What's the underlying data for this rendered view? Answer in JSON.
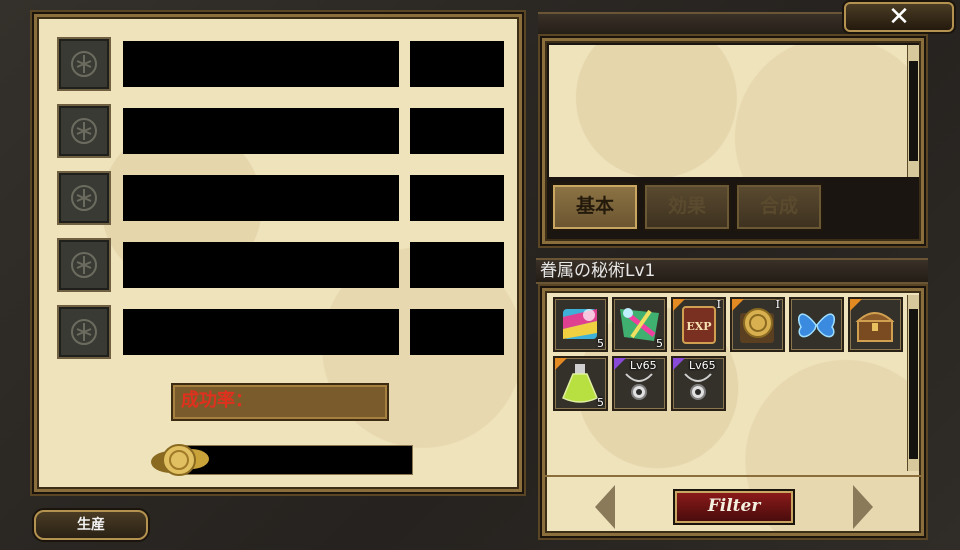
{
  "craft": {
    "rows": [
      {
        "slot_icon": "empty-slot-icon"
      },
      {
        "slot_icon": "empty-slot-icon"
      },
      {
        "slot_icon": "empty-slot-icon"
      },
      {
        "slot_icon": "empty-slot-icon"
      },
      {
        "slot_icon": "empty-slot-icon"
      }
    ],
    "success_label": "成功率：",
    "produce_label": "生産"
  },
  "detail": {
    "close_label": "✕",
    "tabs": [
      {
        "label": "基本",
        "active": true
      },
      {
        "label": "効果",
        "active": false
      },
      {
        "label": "合成",
        "active": false
      }
    ]
  },
  "inventory": {
    "title": "眷属の秘術Lv1",
    "filter_label": "Filter",
    "items": [
      {
        "icon": "rainbow-scroll-icon",
        "qty": "5",
        "tag": "",
        "roman": "",
        "lv": ""
      },
      {
        "icon": "rainbow-scroll-icon",
        "qty": "5",
        "tag": "",
        "roman": "",
        "lv": ""
      },
      {
        "icon": "exp-book-icon",
        "qty": "",
        "tag": "orange",
        "roman": "I",
        "lv": ""
      },
      {
        "icon": "gold-coin-book-icon",
        "qty": "",
        "tag": "orange",
        "roman": "I",
        "lv": ""
      },
      {
        "icon": "blue-butterfly-icon",
        "qty": "",
        "tag": "",
        "roman": "",
        "lv": ""
      },
      {
        "icon": "treasure-chest-icon",
        "qty": "",
        "tag": "orange",
        "roman": "",
        "lv": ""
      },
      {
        "icon": "green-potion-icon",
        "qty": "5",
        "tag": "orange",
        "roman": "",
        "lv": ""
      },
      {
        "icon": "silver-necklace-icon",
        "qty": "",
        "tag": "purple",
        "roman": "",
        "lv": "Lv65"
      },
      {
        "icon": "silver-necklace-icon",
        "qty": "",
        "tag": "purple",
        "roman": "",
        "lv": "Lv65"
      }
    ]
  }
}
